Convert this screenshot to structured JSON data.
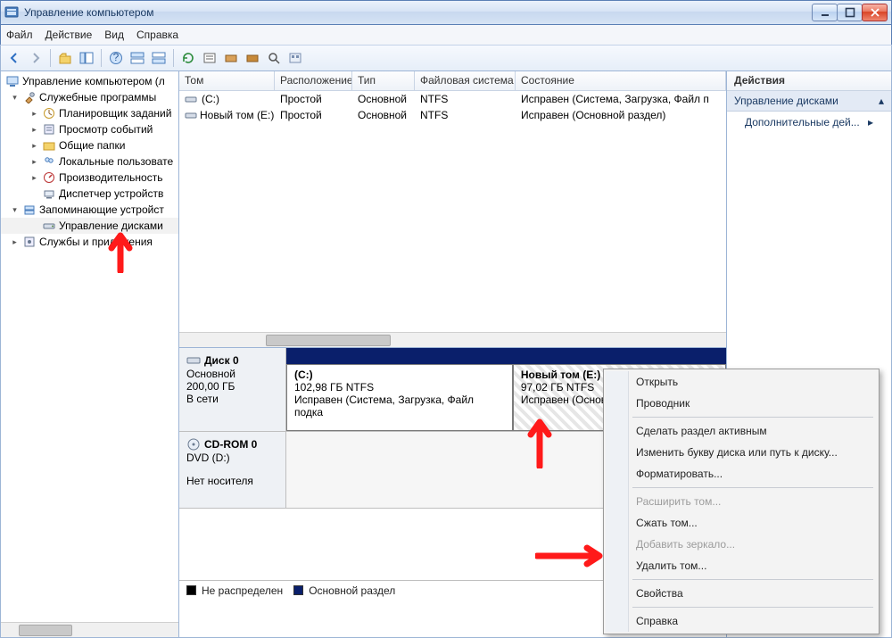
{
  "window": {
    "title": "Управление компьютером"
  },
  "menu": {
    "file": "Файл",
    "action": "Действие",
    "view": "Вид",
    "help": "Справка"
  },
  "tree": {
    "root": "Управление компьютером (л",
    "n1": "Служебные программы",
    "n1a": "Планировщик заданий",
    "n1b": "Просмотр событий",
    "n1c": "Общие папки",
    "n1d": "Локальные пользовате",
    "n1e": "Производительность",
    "n1f": "Диспетчер устройств",
    "n2": "Запоминающие устройст",
    "n2a": "Управление дисками",
    "n3": "Службы и приложения"
  },
  "columns": {
    "vol": "Том",
    "layout": "Расположение",
    "type": "Тип",
    "fs": "Файловая система",
    "status": "Состояние"
  },
  "vols": [
    {
      "name": "(C:)",
      "layout": "Простой",
      "type": "Основной",
      "fs": "NTFS",
      "status": "Исправен (Система, Загрузка, Файл п"
    },
    {
      "name": "Новый том (E:)",
      "layout": "Простой",
      "type": "Основной",
      "fs": "NTFS",
      "status": "Исправен (Основной раздел)"
    }
  ],
  "disk0": {
    "label": "Диск 0",
    "kind": "Основной",
    "size": "200,00 ГБ",
    "state": "В сети",
    "partC": {
      "name": "(C:)",
      "size": "102,98 ГБ NTFS",
      "status": "Исправен (Система, Загрузка, Файл подка"
    },
    "partE": {
      "name": "Новый том  (E:)",
      "size": "97,02 ГБ NTFS",
      "status": "Исправен (Основной"
    }
  },
  "cdrom": {
    "label": "CD-ROM 0",
    "kind": "DVD (D:)",
    "state": "Нет носителя"
  },
  "legend": {
    "unalloc": "Не распределен",
    "primary": "Основной раздел"
  },
  "actions": {
    "header": "Действия",
    "section": "Управление дисками",
    "more": "Дополнительные дей..."
  },
  "ctx": {
    "open": "Открыть",
    "explore": "Проводник",
    "active": "Сделать раздел активным",
    "change": "Изменить букву диска или путь к диску...",
    "format": "Форматировать...",
    "extend": "Расширить том...",
    "shrink": "Сжать том...",
    "mirror": "Добавить зеркало...",
    "delete": "Удалить том...",
    "props": "Свойства",
    "help": "Справка"
  }
}
